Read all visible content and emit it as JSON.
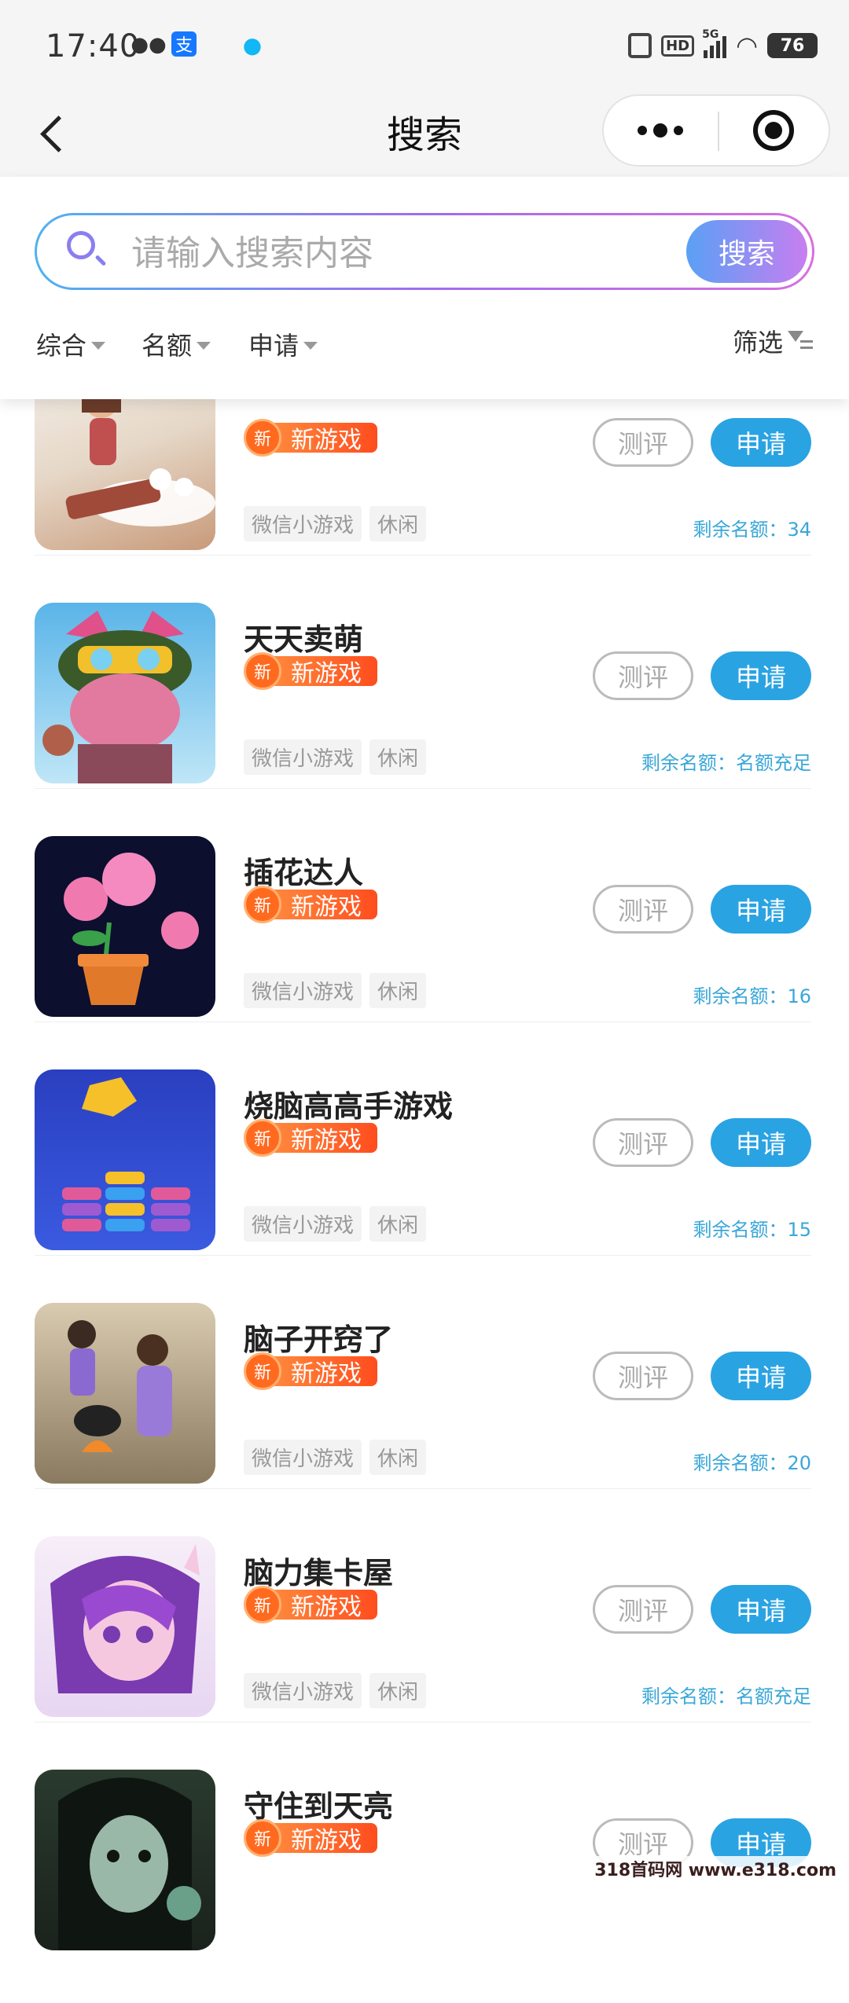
{
  "status_bar": {
    "time": "17:40",
    "network": "5G",
    "battery": "76",
    "hd": "HD",
    "alipay_glyph": "支"
  },
  "nav": {
    "title": "搜索"
  },
  "search": {
    "placeholder": "请输入搜索内容",
    "button": "搜索"
  },
  "filters": {
    "items": [
      "综合",
      "名额",
      "申请"
    ],
    "screen": "筛选"
  },
  "list": {
    "badge_small": "新",
    "badge_text": "新游戏",
    "review_label": "测评",
    "apply_label": "申请",
    "tags": [
      "微信小游戏",
      "休闲"
    ],
    "items": [
      {
        "title": "",
        "quota": "剩余名额：34"
      },
      {
        "title": "天天卖萌",
        "quota": "剩余名额：名额充足"
      },
      {
        "title": "插花达人",
        "quota": "剩余名额：16"
      },
      {
        "title": "烧脑高高手游戏",
        "quota": "剩余名额：15"
      },
      {
        "title": "脑子开窍了",
        "quota": "剩余名额：20"
      },
      {
        "title": "脑力集卡屋",
        "quota": "剩余名额：名额充足"
      },
      {
        "title": "守住到天亮",
        "quota": ""
      }
    ]
  },
  "watermark": "318首码网 www.e318.com",
  "colors": {
    "accent": "#2aa3e3",
    "badge": "#ff5a1f",
    "quota": "#3aa7d8"
  }
}
